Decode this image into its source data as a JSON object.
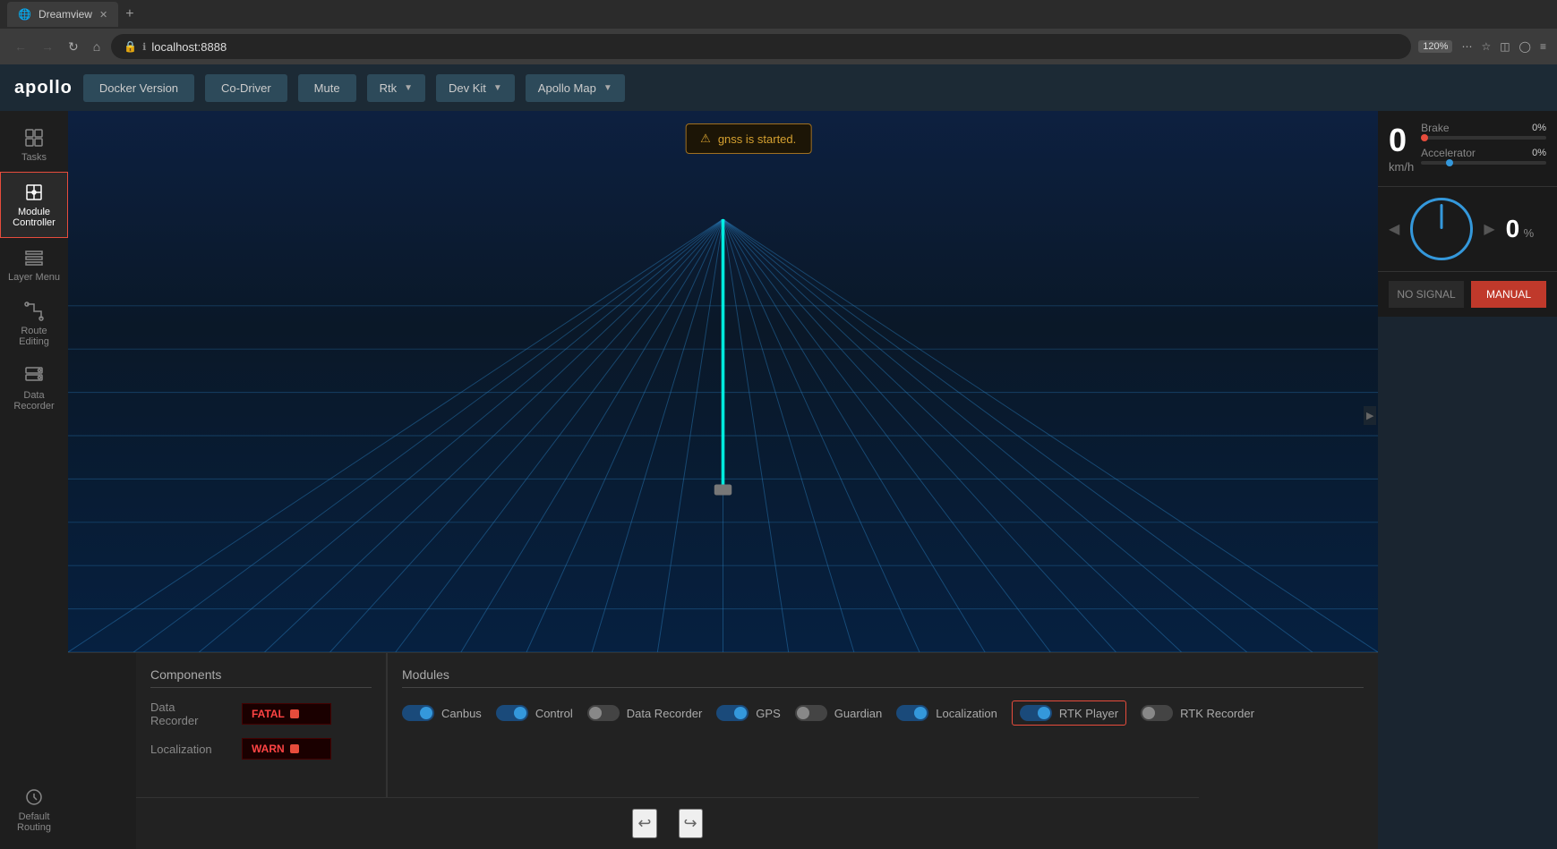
{
  "browser": {
    "tab_title": "Dreamview",
    "url": "localhost:8888",
    "zoom": "120%"
  },
  "header": {
    "logo": "apollo",
    "buttons": {
      "docker_version": "Docker Version",
      "co_driver": "Co-Driver",
      "mute": "Mute"
    },
    "dropdowns": {
      "rtk": "Rtk",
      "dev_kit": "Dev Kit",
      "apollo_map": "Apollo Map"
    }
  },
  "sidebar": {
    "items": [
      {
        "id": "tasks",
        "label": "Tasks",
        "active": false
      },
      {
        "id": "module-controller",
        "label": "Module Controller",
        "active": true
      },
      {
        "id": "layer-menu",
        "label": "Layer Menu",
        "active": false
      },
      {
        "id": "route-editing",
        "label": "Route Editing",
        "active": false
      },
      {
        "id": "data-recorder",
        "label": "Data Recorder",
        "active": false
      }
    ],
    "bottom": {
      "label": "Default Routing"
    }
  },
  "notification": {
    "icon": "⚠",
    "message": "gnss is started."
  },
  "metrics": {
    "speed_value": "0",
    "speed_unit": "km/h",
    "brake_label": "Brake",
    "brake_value": "0%",
    "accelerator_label": "Accelerator",
    "accelerator_value": "0%",
    "steering_value": "0",
    "steering_percent": "%",
    "no_signal": "NO SIGNAL",
    "manual": "MANUAL"
  },
  "components": {
    "title": "Components",
    "rows": [
      {
        "label": "Data\nRecorder",
        "status": "FATAL"
      },
      {
        "label": "Localization",
        "status": "WARN"
      }
    ]
  },
  "modules": {
    "title": "Modules",
    "items": [
      {
        "label": "Canbus",
        "on": true,
        "highlighted": false
      },
      {
        "label": "Control",
        "on": true,
        "highlighted": false
      },
      {
        "label": "Data Recorder",
        "on": false,
        "highlighted": false
      },
      {
        "label": "GPS",
        "on": true,
        "highlighted": false
      },
      {
        "label": "Guardian",
        "on": false,
        "highlighted": false
      },
      {
        "label": "Localization",
        "on": true,
        "highlighted": false
      },
      {
        "label": "RTK Player",
        "on": true,
        "highlighted": true
      },
      {
        "label": "RTK Recorder",
        "on": false,
        "highlighted": false
      }
    ]
  }
}
